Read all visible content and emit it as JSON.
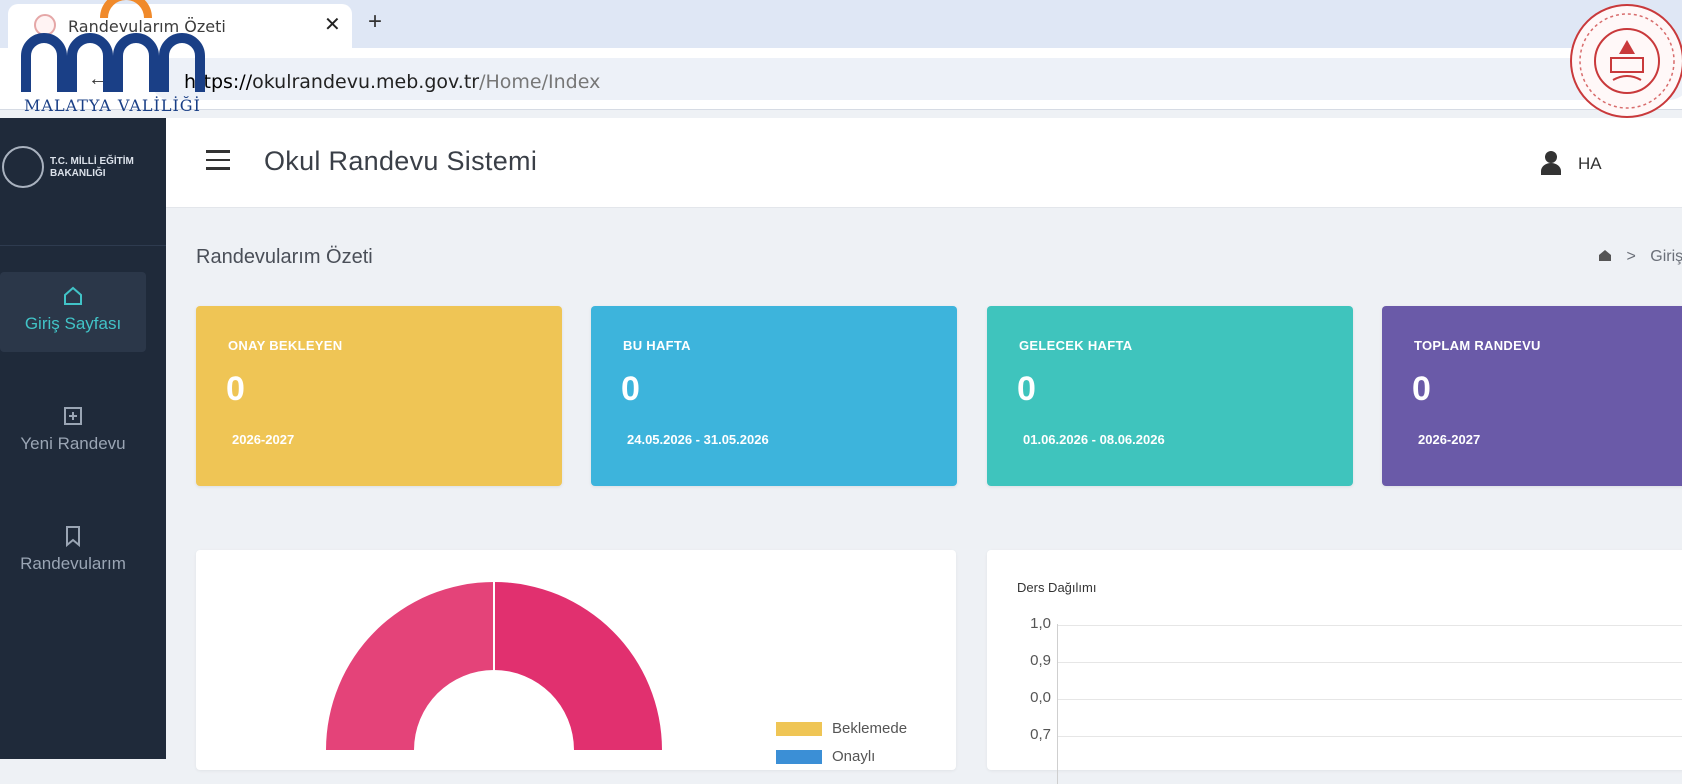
{
  "browser": {
    "tab_title": "Randevularım Özeti",
    "url_domain": "okulrandevu.meb.gov.tr",
    "url_path": "/Home/Index"
  },
  "logos": {
    "left_caption": "MALATYA VALİLİĞİ"
  },
  "sidebar": {
    "brand": "T.C. MİLLİ EĞİTİM BAKANLIĞI",
    "items": [
      {
        "label": "Giriş Sayfası",
        "icon": "home-icon",
        "active": true
      },
      {
        "label": "Yeni Randevu",
        "icon": "plus-square-icon",
        "active": false
      },
      {
        "label": "Randevularım",
        "icon": "bookmark-icon",
        "active": false
      }
    ]
  },
  "header": {
    "title": "Okul Randevu Sistemi",
    "user_name": "HA"
  },
  "page": {
    "title": "Randevularım Özeti",
    "breadcrumb": "Giriş"
  },
  "cards": [
    {
      "label": "ONAY BEKLEYEN",
      "value": "0",
      "sub": "2026-2027",
      "color": "#efc555"
    },
    {
      "label": "BU HAFTA",
      "value": "0",
      "sub": "24.05.2026 - 31.05.2026",
      "color": "#3db4dc"
    },
    {
      "label": "GELECEK HAFTA",
      "value": "0",
      "sub": "01.06.2026 - 08.06.2026",
      "color": "#3fc4bd"
    },
    {
      "label": "TOPLAM RANDEVU",
      "value": "0",
      "sub": "2026-2027",
      "color": "#6a5aa8"
    }
  ],
  "donut": {
    "legend": [
      {
        "label": "Beklemede",
        "color": "#efc555"
      },
      {
        "label": "Onaylı",
        "color": "#3b8fd6"
      }
    ],
    "colors": [
      "#e1306f",
      "#e44379"
    ]
  },
  "bar_chart": {
    "title": "Ders Dağılımı",
    "ticks": [
      "1,0",
      "0,9",
      "0,0",
      "0,7"
    ]
  }
}
